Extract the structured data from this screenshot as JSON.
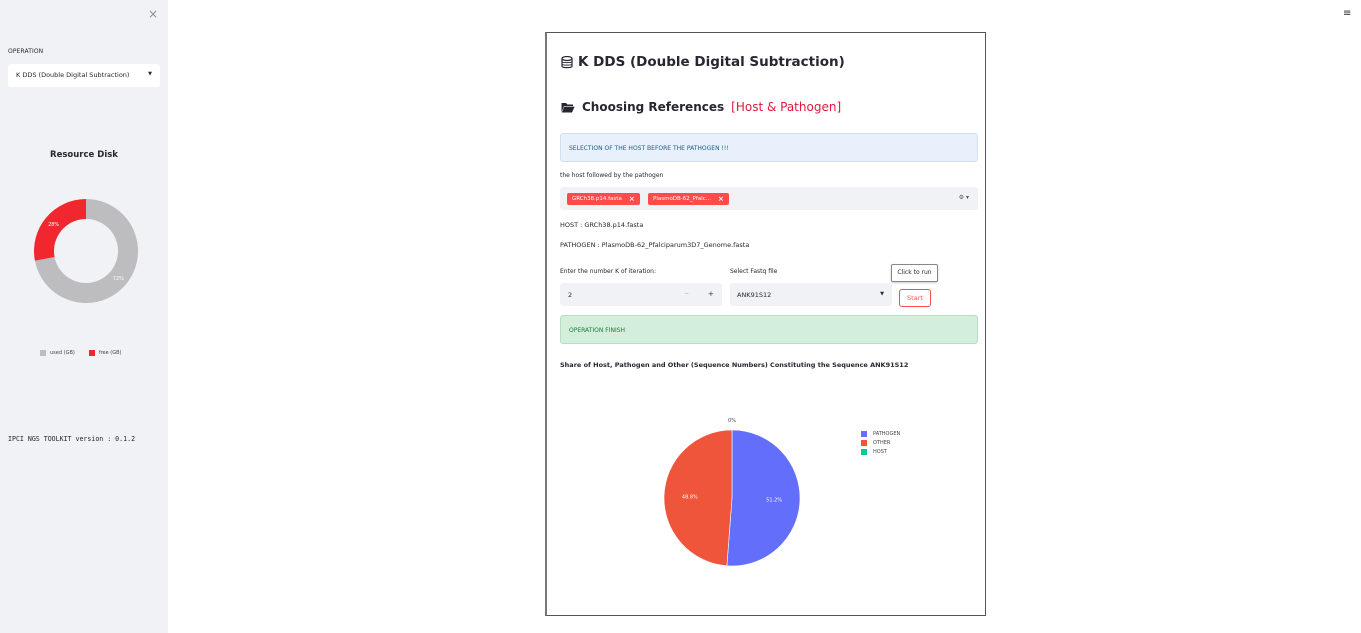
{
  "sidebar": {
    "close_icon": "×",
    "operation_label": "OPERATION",
    "operation_value": "K DDS (Double Digital Subtraction)",
    "disk_title": "Resource Disk",
    "disk_used_pct_label": "72%",
    "disk_free_pct_label": "28%",
    "disk_used_fraction": 0.72,
    "disk_free_fraction": 0.28,
    "legend_used": "used (GB)",
    "legend_free": "free (GB)",
    "used_color": "#bdbdc0",
    "free_color": "#f0272e",
    "version": "IPCI NGS TOOLKIT version : 0.1.2"
  },
  "header": {
    "menu_icon": "≡"
  },
  "main": {
    "title": "K DDS (Double Digital Subtraction)",
    "subtitle": "Choosing References",
    "subtitle_highlight": "[Host & Pathogen]",
    "info_banner": "SELECTION OF THE HOST BEFORE THE PATHOGEN !!!",
    "multiselect_label": "the host followed by the pathogen",
    "tags": [
      "GRCh38.p14.fasta",
      "PlasmoDB-62_Pfalc..."
    ],
    "tag_remove": "×",
    "host_line": "HOST : GRCh38.p14.fasta",
    "pathogen_line": "PATHOGEN : PlasmoDB-62_Pfalciparum3D7_Genome.fasta",
    "k_label": "Enter the number K of iteration:",
    "k_value": "2",
    "k_minus": "−",
    "k_plus": "+",
    "fastq_label": "Select Fastq file",
    "fastq_value": "ANK91S12",
    "tooltip": "Click to run",
    "start_label": "Start",
    "success_banner": "OPERATION FINISH",
    "chart_title": "Share of Host, Pathogen and Other (Sequence Numbers) Constituting the Sequence ANK91S12"
  },
  "chart_data": {
    "type": "pie",
    "title": "Share of Host, Pathogen and Other (Sequence Numbers) Constituting the Sequence ANK91S12",
    "series": [
      {
        "name": "PATHOGEN",
        "value": 51.2,
        "label": "51.2%",
        "color": "#636efa"
      },
      {
        "name": "OTHER",
        "value": 48.8,
        "label": "48.8%",
        "color": "#ef553b"
      },
      {
        "name": "HOST",
        "value": 0,
        "label": "0%",
        "color": "#00cc96"
      }
    ]
  }
}
